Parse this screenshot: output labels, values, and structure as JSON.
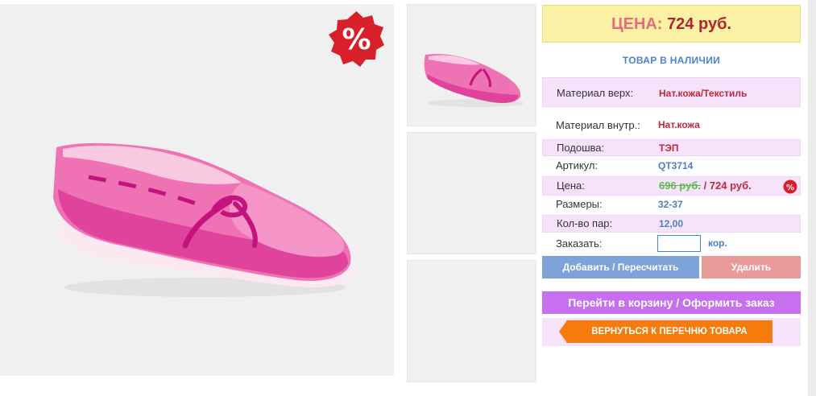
{
  "sale_badge": {
    "symbol": "%",
    "color": "#d8202a"
  },
  "price": {
    "label": "ЦЕНА:",
    "value": "724 руб."
  },
  "stock_status": "ТОВАР В НАЛИЧИИ",
  "specs": [
    {
      "label": "Материал верх:",
      "value": "Нат.кожа/Текстиль"
    },
    {
      "label": "Материал внутр.:",
      "value": "Нат.кожа"
    },
    {
      "label": "Подошва:",
      "value": "ТЭП"
    },
    {
      "label": "Артикул:",
      "value": "QT3714"
    },
    {
      "label": "Цена:",
      "old_value": "696 руб.",
      "separator": " / ",
      "value": "724 руб.",
      "badge": "%"
    },
    {
      "label": "Размеры:",
      "value": "32-37"
    },
    {
      "label": "Кол-во пар:",
      "value": "12,00"
    }
  ],
  "order": {
    "label": "Заказать:",
    "value": "",
    "unit": "кор."
  },
  "buttons": {
    "add": "Добавить / Пересчитать",
    "delete": "Удалить",
    "cart": "Перейти в корзину / Оформить заказ",
    "back": "ВЕРНУТЬСЯ К ПЕРЕЧНЮ ТОВАРА"
  },
  "colors": {
    "product_pink": "#ea6fb3",
    "accent_blue": "#4b84c8",
    "price_red": "#b5222f",
    "back_orange": "#f47b0c"
  }
}
